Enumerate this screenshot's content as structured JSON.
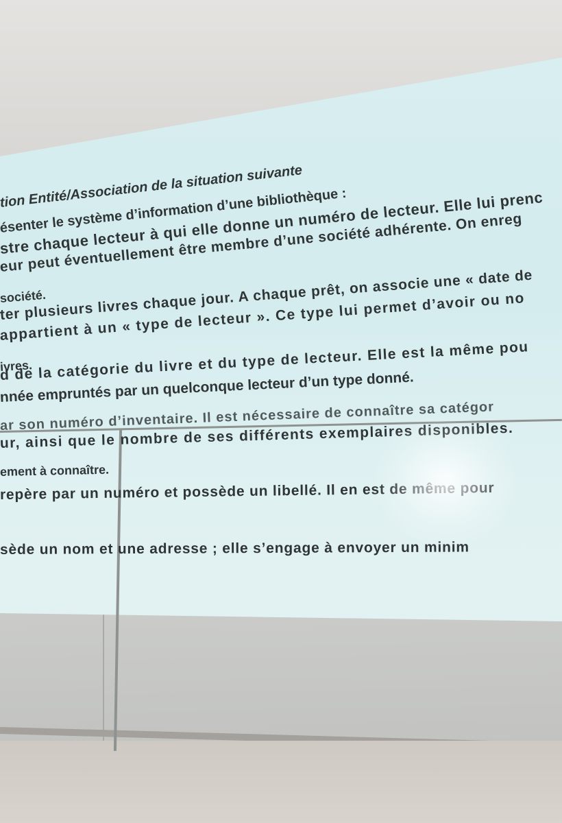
{
  "slide": {
    "title": "tion Entité/Association de la situation suivante",
    "lines": [
      "tion Entité/Association de la situation suivante",
      "ésenter le système d’information d’une bibliothèque :",
      "stre chaque lecteur à qui elle donne un numéro de lecteur. Elle lui prenc",
      "eur peut éventuellement être membre d’une société adhérente. On enreg",
      "société.",
      "ter plusieurs livres chaque jour. A chaque prêt, on associe une « date de",
      "appartient à un « type de lecteur ». Ce type lui permet d’avoir ou no",
      "ivres.",
      "d de la catégorie du livre et du type de lecteur. Elle est la même pou",
      "nnée empruntés par un quelconque lecteur d’un type donné.",
      "ar son numéro d’inventaire. Il est nécessaire de connaître sa catégor",
      "ur, ainsi que le nombre de ses différents exemplaires disponibles.",
      "ement à connaître.",
      "repère par un numéro et possède un libellé. Il en est de même pour",
      "sède un nom et une adresse ; elle s’engage à envoyer un minim"
    ]
  }
}
